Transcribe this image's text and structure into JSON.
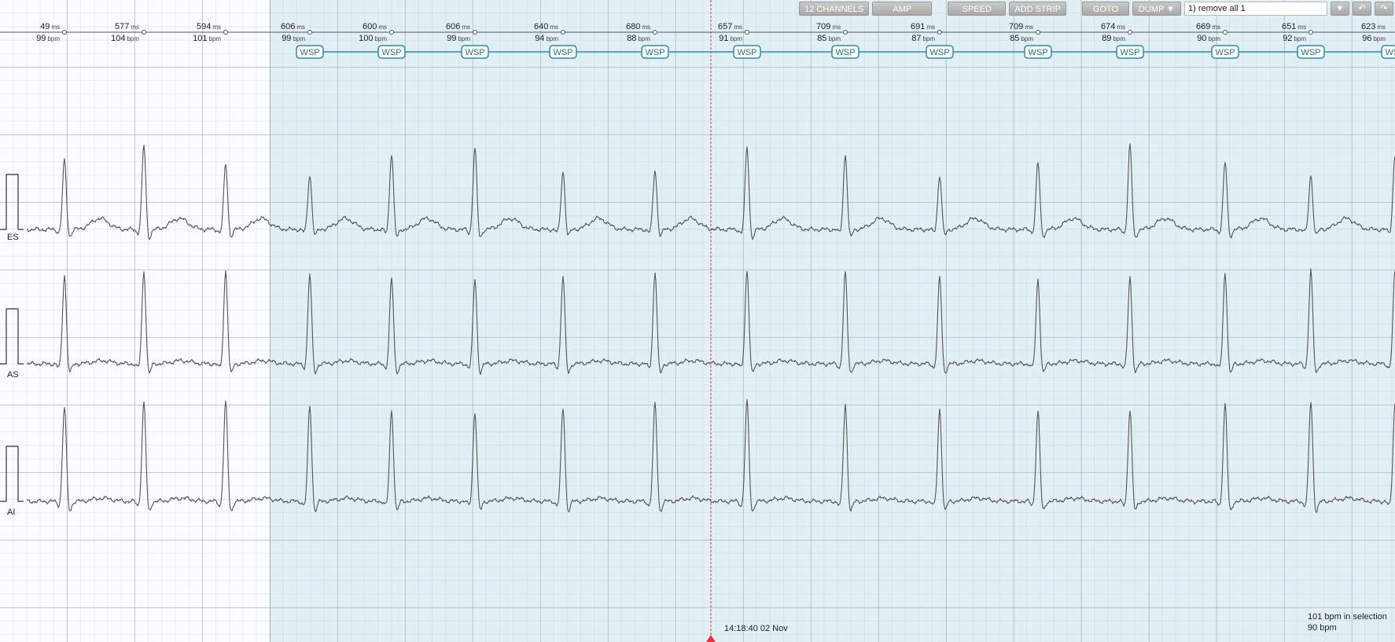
{
  "toolbar": {
    "channels_label": "12 CHANNELS",
    "amp_label": "AMP",
    "speed_label": "SPEED",
    "add_strip_label": "ADD STRIP",
    "goto_label": "GOTO",
    "dump_label": "DUMP ▼",
    "action_select_value": "1) remove all 1",
    "dropdown_glyph": "▼",
    "undo_glyph": "↶",
    "redo_glyph": "↷"
  },
  "rr_intervals": [
    {
      "ms": "49",
      "bpm": "99"
    },
    {
      "ms": "577",
      "bpm": "104"
    },
    {
      "ms": "594",
      "bpm": "101"
    },
    {
      "ms": "606",
      "bpm": "99"
    },
    {
      "ms": "600",
      "bpm": "100"
    },
    {
      "ms": "606",
      "bpm": "99"
    },
    {
      "ms": "640",
      "bpm": "94"
    },
    {
      "ms": "680",
      "bpm": "88"
    },
    {
      "ms": "657",
      "bpm": "91"
    },
    {
      "ms": "709",
      "bpm": "85"
    },
    {
      "ms": "691",
      "bpm": "87"
    },
    {
      "ms": "709",
      "bpm": "85"
    },
    {
      "ms": "674",
      "bpm": "89"
    },
    {
      "ms": "669",
      "bpm": "90"
    },
    {
      "ms": "651",
      "bpm": "92"
    },
    {
      "ms": "623",
      "bpm": "96"
    }
  ],
  "units": {
    "ms": "ms",
    "bpm": "bpm"
  },
  "beat_tag": "WSP",
  "beat_tag_count": 13,
  "leads": [
    "ES",
    "AS",
    "AI"
  ],
  "cursor": {
    "timestamp": "14:18:40 02 Nov"
  },
  "summary": {
    "selection_hr": "101 bpm in selection",
    "current_hr": "90 bpm"
  },
  "colors": {
    "selection": "#d6ecf3",
    "cursor": "#e8323c",
    "trace": "#555555",
    "tag_border": "#2a8fa8",
    "toolbar_button": "#b5b5b5"
  },
  "icons": {
    "cursor_marker": "triangle-up-icon"
  }
}
